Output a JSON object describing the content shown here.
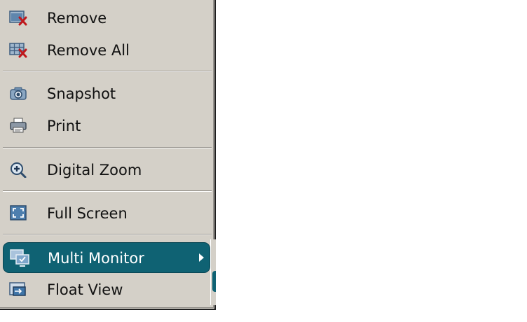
{
  "menu": {
    "items": [
      {
        "label": "Remove",
        "icon": "remove-icon"
      },
      {
        "label": "Remove All",
        "icon": "remove-all-icon"
      },
      {
        "label": "Snapshot",
        "icon": "camera-icon"
      },
      {
        "label": "Print",
        "icon": "printer-icon"
      },
      {
        "label": "Digital Zoom",
        "icon": "zoom-in-icon"
      },
      {
        "label": "Full Screen",
        "icon": "full-screen-icon"
      },
      {
        "label": "Multi Monitor",
        "icon": "multi-monitor-icon",
        "selected": true,
        "has_submenu": true
      },
      {
        "label": "Float View",
        "icon": "float-view-icon"
      }
    ]
  },
  "colors": {
    "menu_background": "#d4d0c8",
    "highlight": "#0f6273",
    "text": "#111111",
    "highlight_text": "#ffffff",
    "remove_accent": "#c0181c"
  }
}
